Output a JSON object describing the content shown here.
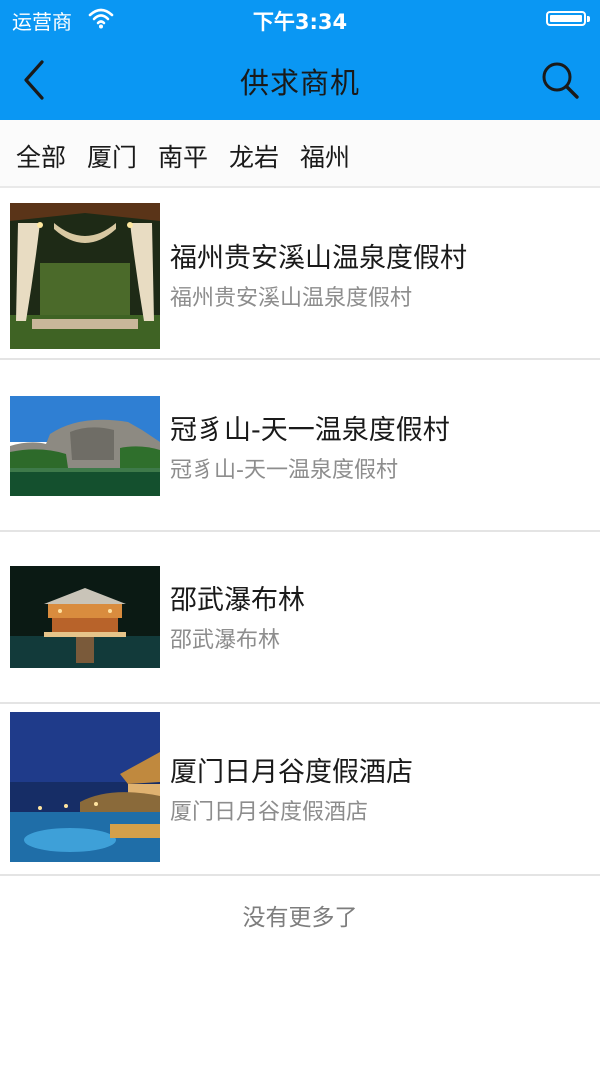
{
  "status": {
    "carrier": "运营商",
    "time": "下午3:34"
  },
  "header": {
    "title": "供求商机",
    "back_icon": "chevron-left-icon",
    "search_icon": "search-icon"
  },
  "filters": [
    "全部",
    "厦门",
    "南平",
    "龙岩",
    "福州"
  ],
  "items": [
    {
      "title": "福州贵安溪山温泉度假村",
      "subtitle": "福州贵安溪山温泉度假村"
    },
    {
      "title": "冠豸山-天一温泉度假村",
      "subtitle": "冠豸山-天一温泉度假村"
    },
    {
      "title": "邵武瀑布林",
      "subtitle": "邵武瀑布林"
    },
    {
      "title": "厦门日月谷度假酒店",
      "subtitle": "厦门日月谷度假酒店"
    }
  ],
  "footer": "没有更多了",
  "colors": {
    "accent": "#0a97f3",
    "text": "#1a1a1a",
    "subtext": "#8d8d8d"
  }
}
